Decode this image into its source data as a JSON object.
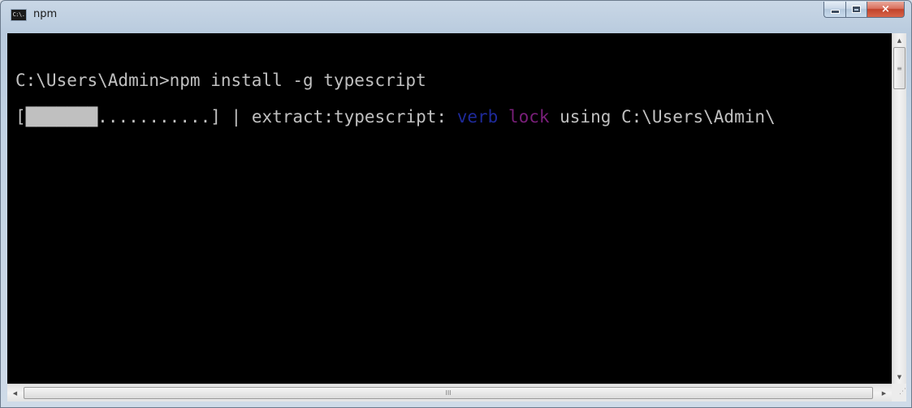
{
  "window": {
    "title": "npm",
    "icon_label": "C:\\.",
    "buttons": {
      "minimize": "minimize-icon",
      "maximize": "maximize-icon",
      "close": "×"
    }
  },
  "console": {
    "line1": "C:\\Users\\Admin>npm install -g typescript",
    "line2": {
      "open_bracket": "[",
      "progress_fill": "███████",
      "progress_empty": "...........",
      "after_bar": "] | extract:typescript: ",
      "verb": "verb",
      "space": " ",
      "lock": "lock",
      "rest": " using C:\\Users\\Admin\\"
    },
    "progress": 0.39,
    "colors": {
      "text": "#c0c0c0",
      "background": "#000000",
      "verb": "#1e2a9a",
      "lock": "#7a1f7a"
    }
  },
  "scrollbars": {
    "up_arrow": "▲",
    "down_arrow": "▼",
    "left_arrow": "◀",
    "right_arrow": "▶",
    "grip": "≡",
    "hgrip": "III",
    "corner_grip": "⋰"
  }
}
